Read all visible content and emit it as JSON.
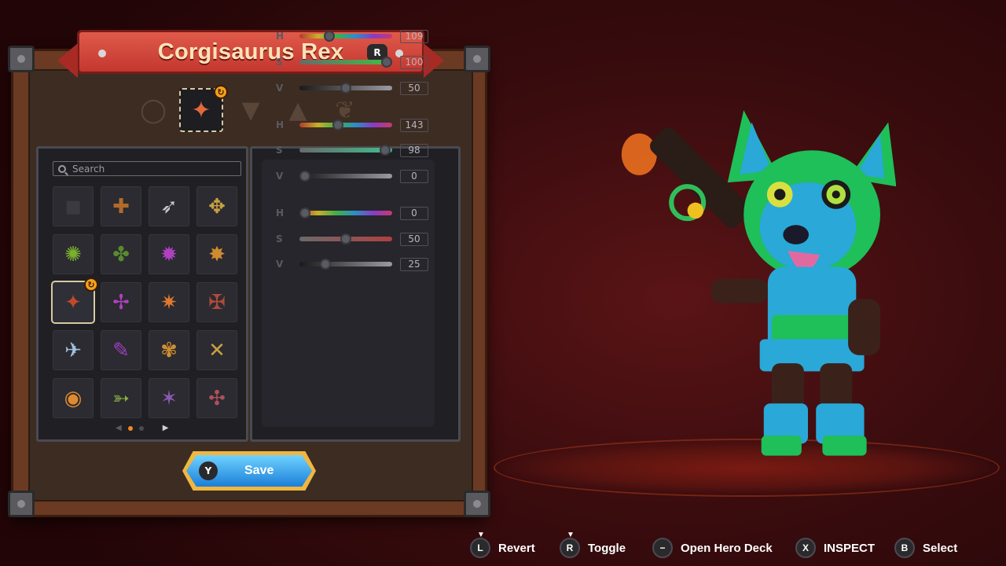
{
  "title": "Corgisaurus Rex",
  "title_button": "R",
  "search": {
    "placeholder": "Search"
  },
  "sliders": [
    {
      "label": "H",
      "value": "109"
    },
    {
      "label": "S",
      "value": "100"
    },
    {
      "label": "V",
      "value": "50"
    },
    {
      "label": "H",
      "value": "143"
    },
    {
      "label": "S",
      "value": "98"
    },
    {
      "label": "V",
      "value": "0"
    },
    {
      "label": "H",
      "value": "0"
    },
    {
      "label": "S",
      "value": "50"
    },
    {
      "label": "V",
      "value": "25"
    }
  ],
  "save": {
    "button": "Y",
    "label": "Save"
  },
  "hints": [
    {
      "button": "L",
      "label": "Revert"
    },
    {
      "button": "R",
      "label": "Toggle"
    },
    {
      "button": "−",
      "label": "Open Hero Deck"
    },
    {
      "button": "X",
      "label": "INSPECT"
    },
    {
      "button": "B",
      "label": "Select"
    }
  ],
  "tabs": [
    "ring-icon",
    "weapon-icon",
    "head-icon",
    "ears-icon",
    "feather-icon"
  ],
  "colors": {
    "accent": "#f0b640",
    "banner": "#c3372f",
    "save": "#1d86e0"
  }
}
